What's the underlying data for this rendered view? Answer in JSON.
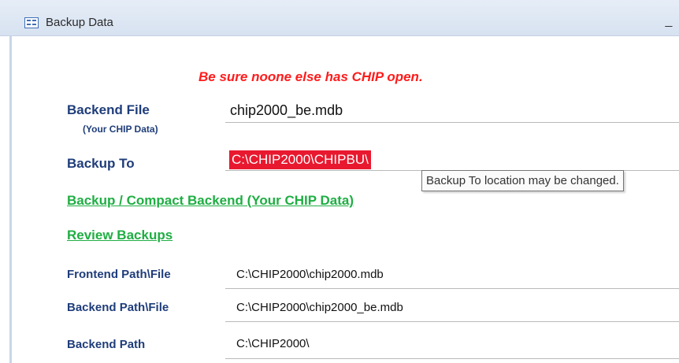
{
  "window": {
    "title": "Backup Data",
    "minimize_glyph": "_",
    "icon": "form-icon"
  },
  "warning": "Be sure noone else has CHIP open.",
  "backend_file": {
    "label": "Backend File",
    "sublabel": "(Your CHIP Data)",
    "value": "chip2000_be.mdb"
  },
  "backup_to": {
    "label": "Backup To",
    "value": "C:\\CHIP2000\\CHIPBU\\",
    "tooltip": "Backup To location may be changed.",
    "highlight_color": "#e8192f"
  },
  "links": {
    "backup_compact": "Backup  / Compact Backend (Your CHIP Data)",
    "review_backups": "Review Backups"
  },
  "paths": {
    "frontend_path_file": {
      "label": "Frontend Path\\File",
      "value": "C:\\CHIP2000\\chip2000.mdb"
    },
    "backend_path_file": {
      "label": "Backend Path\\File",
      "value": "C:\\CHIP2000\\chip2000_be.mdb"
    },
    "backend_path": {
      "label": "Backend Path",
      "value": "C:\\CHIP2000\\"
    }
  },
  "colors": {
    "label_blue": "#1f3d7a",
    "link_green": "#1fae43",
    "warning_red": "#ff1c1c"
  }
}
